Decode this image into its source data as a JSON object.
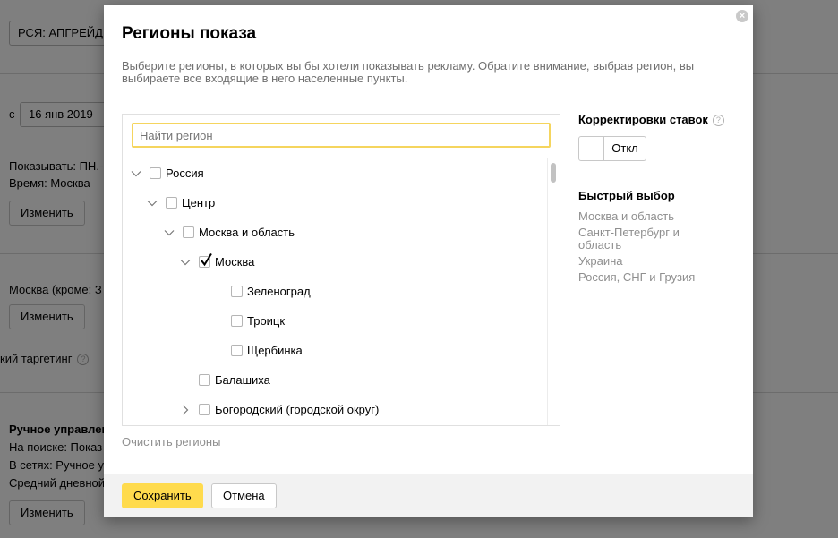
{
  "background": {
    "campaign_select": "РСЯ: АПГРЕЙД ПО",
    "date_prefix": "с",
    "date_value": "16 янв 2019",
    "show_days": "Показывать: ПН.-ПТ.",
    "time_zone": "Время: Москва",
    "change_button": "Изменить",
    "regions_summary": "Москва (кроме: З",
    "targeting_label": "кий таргетинг",
    "help_glyph": "?",
    "strategy_title": "Ручное управление",
    "strategy_search": "На поиске: Показ",
    "strategy_networks": "В сетях: Ручное уп",
    "strategy_budget": "Средний дневной"
  },
  "modal": {
    "title": "Регионы показа",
    "close_glyph": "×",
    "description": "Выберите регионы, в которых вы бы хотели показывать рекламу. Обратите внимание, выбрав регион, вы выбираете все входящие в него населенные пункты.",
    "search_placeholder": "Найти регион",
    "tree": [
      {
        "label": "Россия",
        "depth": 0,
        "chevron": "down",
        "checked": false
      },
      {
        "label": "Центр",
        "depth": 1,
        "chevron": "down",
        "checked": false
      },
      {
        "label": "Москва и область",
        "depth": 2,
        "chevron": "down",
        "checked": false
      },
      {
        "label": "Москва",
        "depth": 3,
        "chevron": "down",
        "checked": true
      },
      {
        "label": "Зеленоград",
        "depth": 4,
        "chevron": "none",
        "checked": false
      },
      {
        "label": "Троицк",
        "depth": 4,
        "chevron": "none",
        "checked": false
      },
      {
        "label": "Щербинка",
        "depth": 4,
        "chevron": "none",
        "checked": false
      },
      {
        "label": "Балашиха",
        "depth": 3,
        "chevron": "none",
        "checked": false
      },
      {
        "label": "Богородский (городской округ)",
        "depth": 3,
        "chevron": "right",
        "checked": false
      }
    ],
    "clear_link": "Очистить регионы",
    "bid_adjust_title": "Корректировки ставок",
    "help_glyph": "?",
    "toggle_label": "Откл",
    "quick_title": "Быстрый выбор",
    "quick_items": [
      "Москва и область",
      "Санкт-Петербург и область",
      "Украина",
      "Россия, СНГ и Грузия"
    ],
    "save_button": "Сохранить",
    "cancel_button": "Отмена"
  },
  "colors": {
    "accent_yellow": "#ffdb4d",
    "focus_border": "#f5d55e",
    "muted_text": "#8f8f8f"
  }
}
